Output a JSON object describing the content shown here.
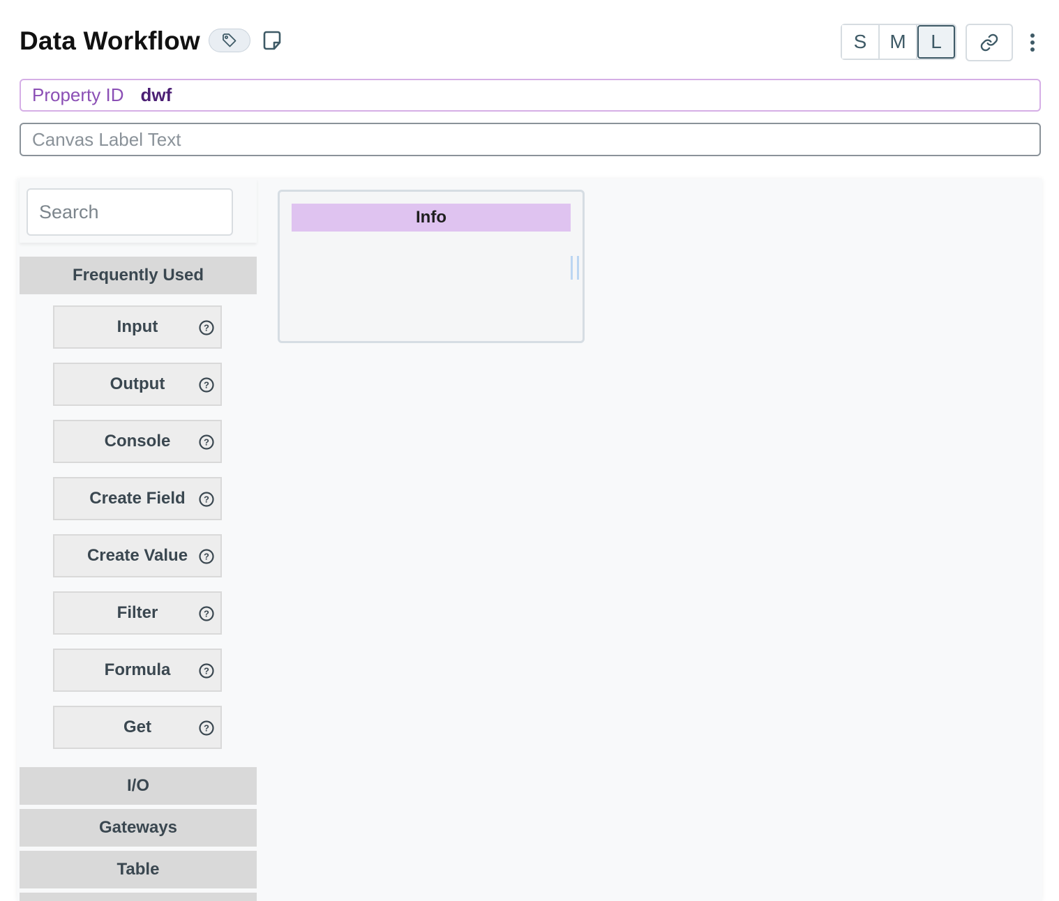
{
  "header": {
    "title": "Data Workflow",
    "size_options": [
      "S",
      "M",
      "L"
    ],
    "active_size": "L"
  },
  "property": {
    "label": "Property ID",
    "value": "dwf"
  },
  "canvas_label": {
    "value": "",
    "placeholder": "Canvas Label Text"
  },
  "sidebar": {
    "search_placeholder": "Search",
    "frequently_used_label": "Frequently Used",
    "items": [
      {
        "label": "Input",
        "icon": "help-icon"
      },
      {
        "label": "Output",
        "icon": "help-icon"
      },
      {
        "label": "Console",
        "icon": "help-icon"
      },
      {
        "label": "Create Field",
        "icon": "help-icon"
      },
      {
        "label": "Create Value",
        "icon": "help-icon"
      },
      {
        "label": "Filter",
        "icon": "help-icon"
      },
      {
        "label": "Formula",
        "icon": "help-icon"
      },
      {
        "label": "Get",
        "icon": "help-icon"
      }
    ],
    "categories": [
      "I/O",
      "Gateways",
      "Table"
    ]
  },
  "canvas": {
    "info_node_title": "Info"
  },
  "colors": {
    "accent": "#3e5a66",
    "property_border": "#d5aee6",
    "property_label": "#8b4fb5",
    "property_value": "#4b1f74",
    "info_header": "#dfc3f0",
    "category_bg": "#d9d9d9"
  }
}
